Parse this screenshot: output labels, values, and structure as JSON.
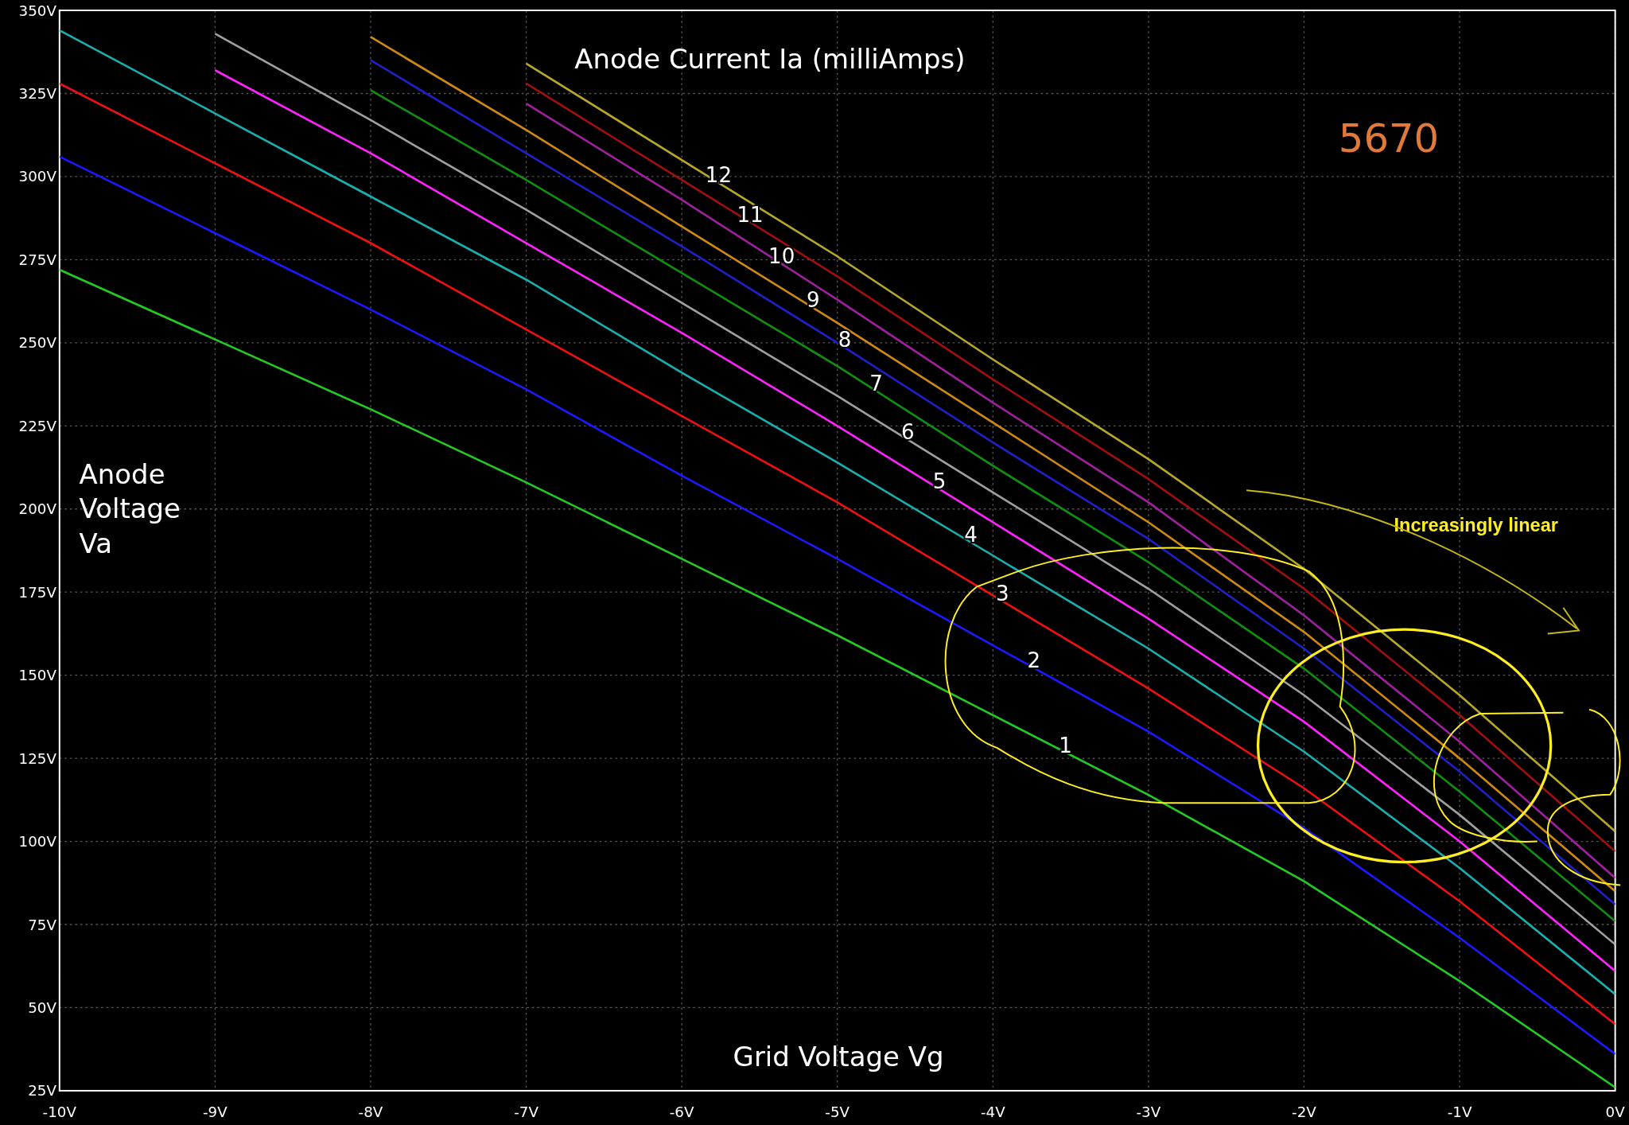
{
  "chart_data": {
    "type": "line",
    "title": "Anode Current Ia (milliAmps)",
    "xlabel": "Grid Voltage Vg",
    "ylabel": "Anode Voltage Va",
    "x": [
      -10,
      -9,
      -8,
      -7,
      -6,
      -5,
      -4,
      -3,
      -2,
      -1,
      0
    ],
    "series": [
      {
        "name": "1",
        "color": "#22cc22",
        "values": [
          272,
          251,
          230,
          208,
          185,
          162,
          138,
          114,
          88,
          58,
          26
        ]
      },
      {
        "name": "2",
        "color": "#1a1aff",
        "values": [
          306,
          283,
          260,
          236,
          210,
          185,
          159,
          133,
          104,
          71,
          36
        ]
      },
      {
        "name": "3",
        "color": "#ee1111",
        "values": [
          328,
          304,
          280,
          254,
          228,
          202,
          174,
          146,
          116,
          82,
          45
        ]
      },
      {
        "name": "4",
        "color": "#19b0b0",
        "values": [
          344,
          319,
          294,
          269,
          241,
          214,
          186,
          158,
          127,
          92,
          54
        ]
      },
      {
        "name": "5",
        "color": "#ff22ff",
        "values": [
          null,
          332,
          307,
          280,
          253,
          225,
          196,
          167,
          136,
          100,
          61
        ]
      },
      {
        "name": "6",
        "color": "#a0a0a0",
        "values": [
          null,
          343,
          317,
          290,
          262,
          234,
          205,
          176,
          144,
          108,
          69
        ]
      },
      {
        "name": "7",
        "color": "#109010",
        "values": [
          null,
          null,
          326,
          299,
          271,
          243,
          213,
          184,
          152,
          115,
          76
        ]
      },
      {
        "name": "8",
        "color": "#2020c8",
        "values": [
          null,
          null,
          335,
          307,
          279,
          250,
          220,
          191,
          158,
          121,
          81
        ]
      },
      {
        "name": "9",
        "color": "#d08a10",
        "values": [
          null,
          null,
          342,
          314,
          285,
          256,
          226,
          196,
          163,
          125,
          85
        ]
      },
      {
        "name": "10",
        "color": "#a020a0",
        "values": [
          null,
          null,
          null,
          322,
          293,
          263,
          232,
          202,
          168,
          130,
          89
        ]
      },
      {
        "name": "11",
        "color": "#a01010",
        "values": [
          null,
          null,
          null,
          328,
          299,
          270,
          239,
          209,
          176,
          138,
          97
        ]
      },
      {
        "name": "12",
        "color": "#b8a828",
        "values": [
          null,
          null,
          null,
          334,
          305,
          276,
          245,
          215,
          182,
          144,
          103
        ]
      }
    ],
    "xlim": [
      -10,
      0
    ],
    "ylim": [
      25,
      350
    ],
    "grid": true,
    "xticks": [
      {
        "value": -10,
        "label": "-10V"
      },
      {
        "value": -9,
        "label": "-9V"
      },
      {
        "value": -8,
        "label": "-8V"
      },
      {
        "value": -7,
        "label": "-7V"
      },
      {
        "value": -6,
        "label": "-6V"
      },
      {
        "value": -5,
        "label": "-5V"
      },
      {
        "value": -4,
        "label": "-4V"
      },
      {
        "value": -3,
        "label": "-3V"
      },
      {
        "value": -2,
        "label": "-2V"
      },
      {
        "value": -1,
        "label": "-1V"
      },
      {
        "value": 0,
        "label": "0V"
      }
    ],
    "yticks": [
      {
        "value": 25,
        "label": "25V"
      },
      {
        "value": 50,
        "label": "50V"
      },
      {
        "value": 75,
        "label": "75V"
      },
      {
        "value": 100,
        "label": "100V"
      },
      {
        "value": 125,
        "label": "125V"
      },
      {
        "value": 150,
        "label": "150V"
      },
      {
        "value": 175,
        "label": "175V"
      },
      {
        "value": 200,
        "label": "200V"
      },
      {
        "value": 225,
        "label": "225V"
      },
      {
        "value": 250,
        "label": "250V"
      },
      {
        "value": 275,
        "label": "275V"
      },
      {
        "value": 300,
        "label": "300V"
      },
      {
        "value": 325,
        "label": "325V"
      },
      {
        "value": 350,
        "label": "350V"
      }
    ],
    "annotations": [
      "5670",
      "Increasingly linear"
    ]
  }
}
